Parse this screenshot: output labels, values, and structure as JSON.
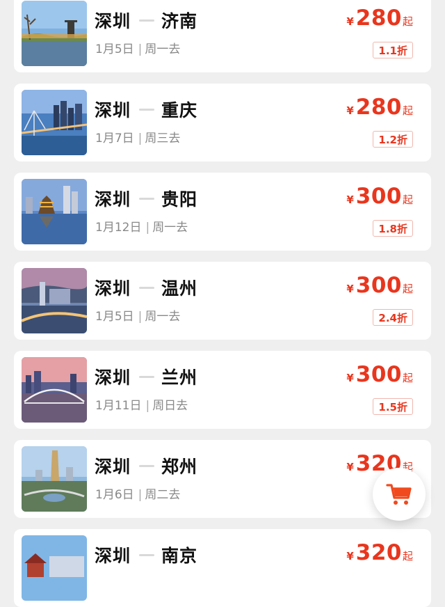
{
  "flights": [
    {
      "from": "深圳",
      "to": "济南",
      "date": "1月5日",
      "weekday": "周一去",
      "currency": "¥",
      "price": "280",
      "price_suffix": "起",
      "discount": "1.1折",
      "scene": "park-tower"
    },
    {
      "from": "深圳",
      "to": "重庆",
      "date": "1月7日",
      "weekday": "周三去",
      "currency": "¥",
      "price": "280",
      "price_suffix": "起",
      "discount": "1.2折",
      "scene": "bridge-city"
    },
    {
      "from": "深圳",
      "to": "贵阳",
      "date": "1月12日",
      "weekday": "周一去",
      "currency": "¥",
      "price": "300",
      "price_suffix": "起",
      "discount": "1.8折",
      "scene": "pavilion-night"
    },
    {
      "from": "深圳",
      "to": "温州",
      "date": "1月5日",
      "weekday": "周一去",
      "currency": "¥",
      "price": "300",
      "price_suffix": "起",
      "discount": "2.4折",
      "scene": "river-city"
    },
    {
      "from": "深圳",
      "to": "兰州",
      "date": "1月11日",
      "weekday": "周日去",
      "currency": "¥",
      "price": "300",
      "price_suffix": "起",
      "discount": "1.5折",
      "scene": "arch-bridge"
    },
    {
      "from": "深圳",
      "to": "郑州",
      "date": "1月6日",
      "weekday": "周二去",
      "currency": "¥",
      "price": "320",
      "price_suffix": "起",
      "discount": "",
      "scene": "tall-tower"
    },
    {
      "from": "深圳",
      "to": "南京",
      "date": "",
      "weekday": "",
      "currency": "¥",
      "price": "320",
      "price_suffix": "起",
      "discount": "",
      "scene": "temple"
    }
  ],
  "floating_cart": {
    "icon": "shopping-cart-icon"
  },
  "colors": {
    "accent": "#e8361e",
    "badge_border": "#f0b7ad",
    "background": "#efefef"
  }
}
